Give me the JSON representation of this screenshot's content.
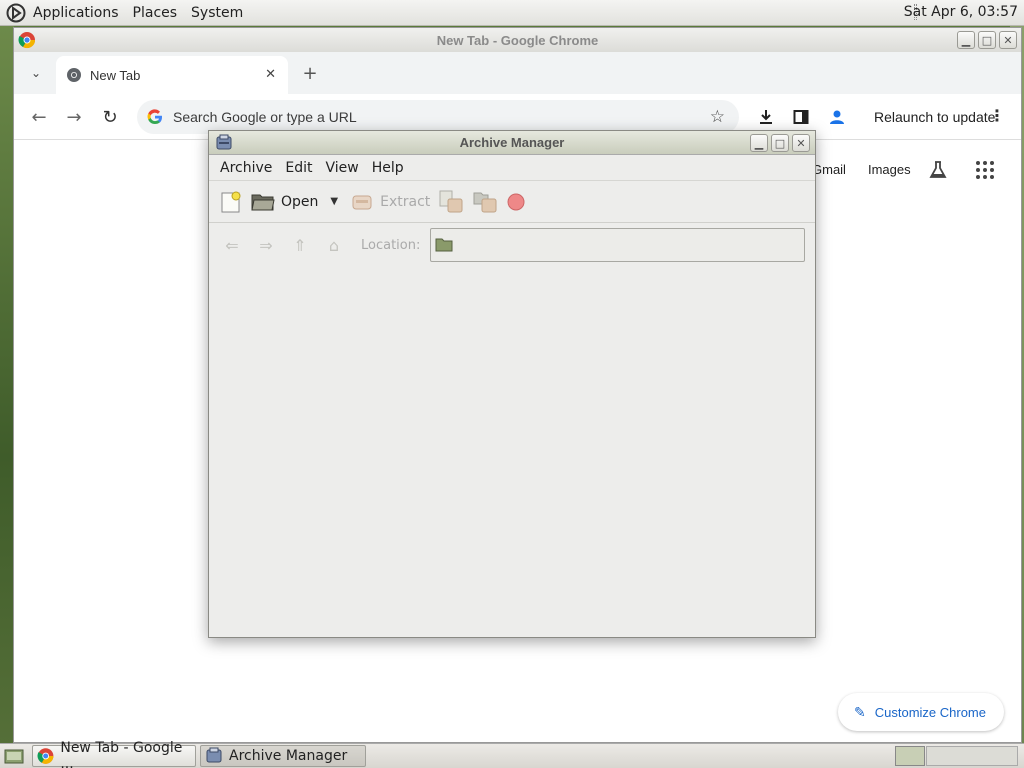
{
  "top_panel": {
    "menus": [
      "Applications",
      "Places",
      "System"
    ],
    "clock": "Sat Apr  6, 03:57"
  },
  "chrome": {
    "window_title": "New Tab - Google Chrome",
    "tab_title": "New Tab",
    "omnibox_placeholder": "Search Google or type a URL",
    "relaunch_label": "Relaunch to update",
    "ntp_links": [
      "Gmail",
      "Images"
    ],
    "customize_label": "Customize Chrome"
  },
  "archive_manager": {
    "title": "Archive Manager",
    "menus": [
      "Archive",
      "Edit",
      "View",
      "Help"
    ],
    "toolbar": {
      "open_label": "Open",
      "extract_label": "Extract"
    },
    "location_label": "Location:"
  },
  "taskbar": {
    "tasks": [
      "New Tab - Google ...",
      "Archive Manager"
    ]
  },
  "colors": {
    "chrome_accent": "#1a73e8",
    "desktop": "#5a7a3a"
  }
}
